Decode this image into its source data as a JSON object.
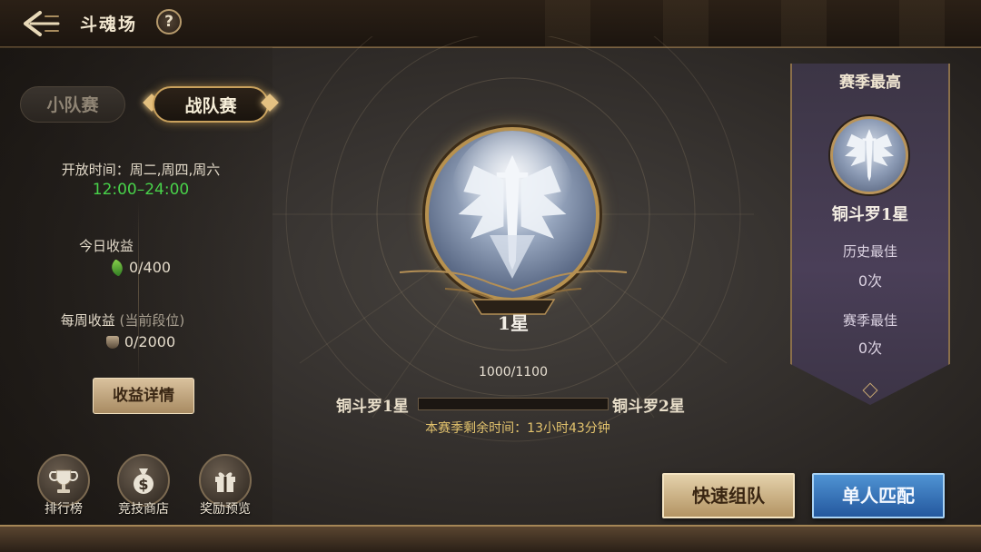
{
  "header": {
    "title": "斗魂场",
    "help_label": "?"
  },
  "tabs": [
    {
      "label": "小队赛",
      "active": false
    },
    {
      "label": "战队赛",
      "active": true
    }
  ],
  "left": {
    "open_time_label": "开放时间：周二,周四,周六",
    "open_hours": "12:00–24:00",
    "today_label": "今日收益",
    "today_value": "0/400",
    "weekly_label": "每周收益",
    "weekly_sub": "(当前段位)",
    "weekly_value": "0/2000",
    "detail_button": "收益详情"
  },
  "bottom_icons": [
    {
      "label": "排行榜",
      "icon": "trophy-icon"
    },
    {
      "label": "竞技商店",
      "icon": "money-bag-icon"
    },
    {
      "label": "奖励预览",
      "icon": "gift-icon"
    }
  ],
  "center": {
    "star_label": "1星",
    "progress_text": "1000/1100",
    "progress_fraction": 0.0,
    "current_rank": "铜斗罗1星",
    "next_rank": "铜斗罗2星",
    "season_remaining": "本赛季剩余时间：13小时43分钟"
  },
  "right_panel": {
    "title": "赛季最高",
    "rank": "铜斗罗1星",
    "history_best_label": "历史最佳",
    "history_best_value": "0次",
    "season_best_label": "赛季最佳",
    "season_best_value": "0次"
  },
  "actions": {
    "quick_team": "快速组队",
    "solo_match": "单人匹配"
  },
  "colors": {
    "gold_accent": "#c9a15d",
    "open_hours_green": "#48d24a",
    "season_text_gold": "#e3c36d",
    "match_button_blue": "#3a78bd"
  }
}
